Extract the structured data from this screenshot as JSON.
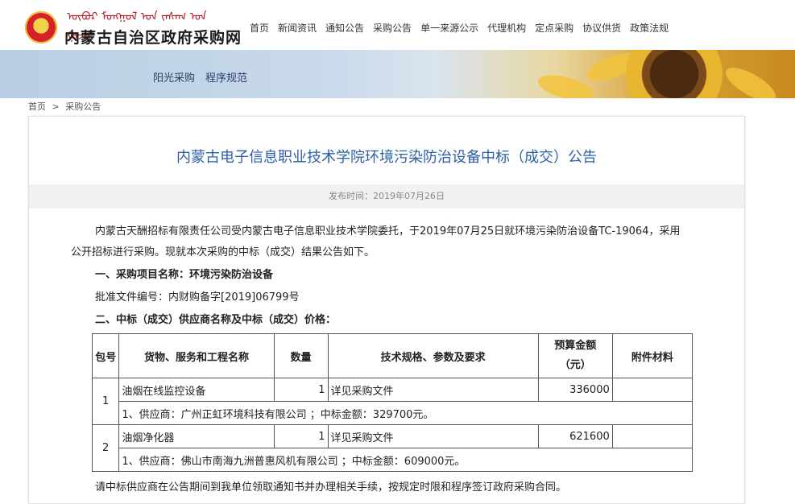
{
  "header": {
    "mongolian_text": "ᠦᠪᠦᠷ ᠮᠣᠩᠭᠣᠯ ᠤᠨ ᠵᠠᠰᠠᠭ ᠤᠨ ᠭᠠᠵᠠᠷ",
    "site_title": "内蒙古自治区政府采购网",
    "nav": [
      "首页",
      "新闻资讯",
      "通知公告",
      "采购公告",
      "单一来源公示",
      "代理机构",
      "定点采购",
      "协议供货",
      "政策法规"
    ]
  },
  "banner": {
    "slogan": "阳光采购　程序规范"
  },
  "breadcrumb": {
    "home": "首页",
    "sep": ">",
    "current": "采购公告"
  },
  "article": {
    "title": "内蒙古电子信息职业技术学院环境污染防治设备中标（成交）公告",
    "publish_time": "发布时间：2019年07月26日",
    "intro_line1": "内蒙古天酬招标有限责任公司受内蒙古电子信息职业技术学院委托，于2019年07月25日就环境污染防治设备TC-19064，采用",
    "intro_line2": "公开招标进行采购。现就本次采购的中标（成交）结果公告如下。",
    "section1": "一、采购项目名称：环境污染防治设备",
    "approval": "批准文件编号：内财购备字[2019]06799号",
    "section2": "二、中标（成交）供应商名称及中标（成交）价格：",
    "table": {
      "headers": [
        "包号",
        "货物、服务和工程名称",
        "数量",
        "技术规格、参数及要求",
        "预算金额\n（元）",
        "附件材料"
      ],
      "rows": [
        {
          "package": "1",
          "item": "油烟在线监控设备",
          "qty": "1",
          "spec": "详见采购文件",
          "budget": "336000",
          "attachment": "",
          "supplier": "1、供应商：广州正虹环境科技有限公司 ；中标金额：329700元。"
        },
        {
          "package": "2",
          "item": "油烟净化器",
          "qty": "1",
          "spec": "详见采购文件",
          "budget": "621600",
          "attachment": "",
          "supplier": "1、供应商：佛山市南海九洲普惠风机有限公司 ；中标金额：609000元。"
        }
      ]
    },
    "footer_note": "请中标供应商在公告期间到我单位领取通知书并办理相关手续，按规定时限和程序签订政府采购合同。"
  },
  "colors": {
    "title_blue": "#2d5ea8",
    "emblem_red": "#d4212a"
  }
}
